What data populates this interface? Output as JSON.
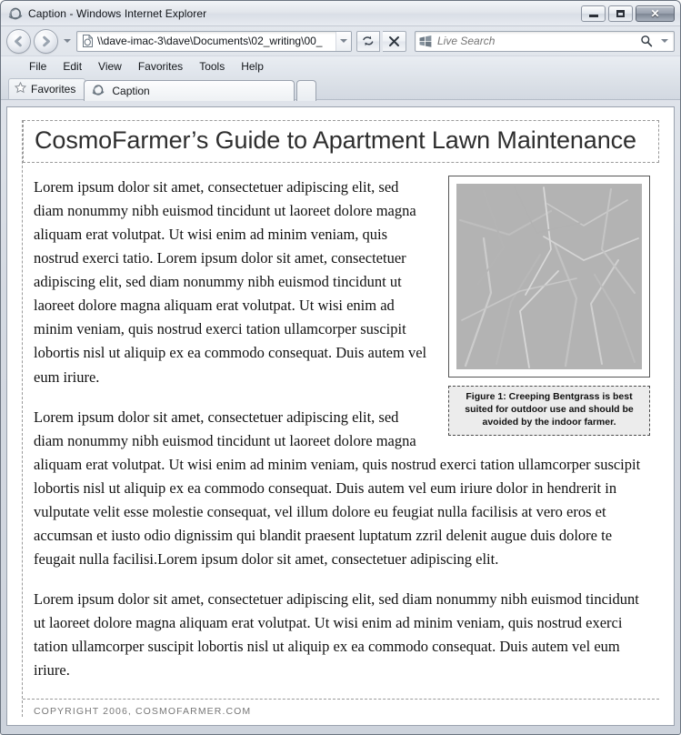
{
  "window": {
    "title": "Caption - Windows Internet Explorer",
    "app_icon": "internet-explorer-icon",
    "buttons": {
      "minimize": "minimize-button",
      "maximize": "maximize-button",
      "close": "close-button",
      "close_glyph": "✕"
    }
  },
  "navbar": {
    "back_label": "Back",
    "forward_label": "Forward",
    "recent_pages_label": "Recent Pages",
    "address_value": "\\\\dave-imac-3\\dave\\Documents\\02_writing\\00_",
    "address_placeholder": "",
    "address_icon": "page-icon",
    "refresh_label": "Refresh",
    "stop_label": "Stop",
    "stop_glyph": "✕",
    "search_value": "",
    "search_placeholder": "Live Search",
    "search_logo": "windows-logo-icon",
    "search_go_icon": "search-icon",
    "search_caret_icon": "chevron-down-icon"
  },
  "menubar": {
    "items": [
      {
        "label": "File"
      },
      {
        "label": "Edit"
      },
      {
        "label": "View"
      },
      {
        "label": "Favorites"
      },
      {
        "label": "Tools"
      },
      {
        "label": "Help"
      }
    ]
  },
  "tabstrip": {
    "favorites_label": "Favorites",
    "favorites_icon": "star-icon",
    "tabs": [
      {
        "label": "Caption",
        "icon": "internet-explorer-icon",
        "active": true
      }
    ],
    "new_tab_label": ""
  },
  "page": {
    "headline": "CosmoFarmer’s Guide to Apartment Lawn Maintenance",
    "paragraphs": [
      "Lorem ipsum dolor sit amet, consectetuer adipiscing elit, sed diam nonummy nibh euismod tincidunt ut laoreet dolore magna aliquam erat volutpat. Ut wisi enim ad minim veniam, quis nostrud exerci tatio. Lorem ipsum dolor sit amet, consectetuer adipiscing elit, sed diam nonummy nibh euismod tincidunt ut laoreet dolore magna aliquam erat volutpat. Ut wisi enim ad minim veniam, quis nostrud exerci tation ullamcorper suscipit lobortis nisl ut aliquip ex ea commodo consequat. Duis autem vel eum iriure.",
      "Lorem ipsum dolor sit amet, consectetuer adipiscing elit, sed diam nonummy nibh euismod tincidunt ut laoreet dolore magna aliquam erat volutpat. Ut wisi enim ad minim veniam, quis nostrud exerci tation ullamcorper suscipit lobortis nisl ut aliquip ex ea commodo consequat. Duis autem vel eum iriure dolor in hendrerit in vulputate velit esse molestie consequat, vel illum dolore eu feugiat nulla facilisis at vero eros et accumsan et iusto odio dignissim qui blandit praesent luptatum zzril delenit augue duis dolore te feugait nulla facilisi.Lorem ipsum dolor sit amet, consectetuer adipiscing elit.",
      "Lorem ipsum dolor sit amet, consectetuer adipiscing elit, sed diam nonummy nibh euismod tincidunt ut laoreet dolore magna aliquam erat volutpat. Ut wisi enim ad minim veniam, quis nostrud exerci tation ullamcorper suscipit lobortis nisl ut aliquip ex ea commodo consequat. Duis autem vel eum iriure."
    ],
    "figure": {
      "image_alt": "grass-photo",
      "caption": "Figure 1: Creeping Bentgrass is best suited for outdoor use and should be avoided by the indoor farmer."
    },
    "footer": "Copyright 2006, cosmofarmer.com"
  },
  "colors": {
    "dashed_border": "#9a9a9a",
    "caption_background": "#ececec",
    "headline_text": "#2e2e2e",
    "footer_text": "#777777",
    "figure_border": "#555555"
  }
}
